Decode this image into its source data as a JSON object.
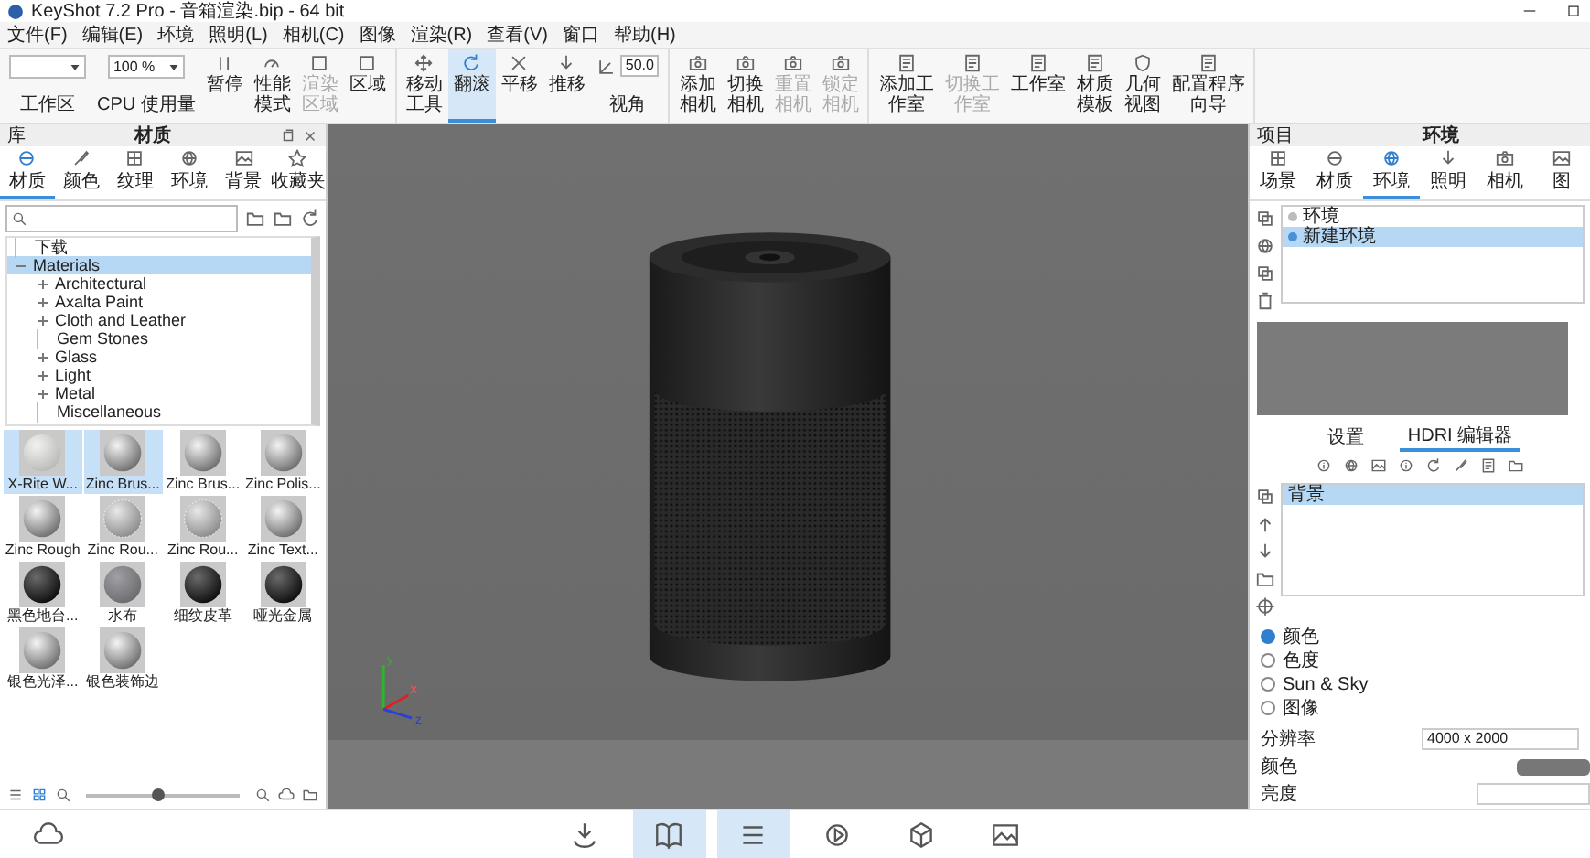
{
  "window": {
    "title": "KeyShot 7.2 Pro - 音箱渲染.bip - 64 bit"
  },
  "menu": [
    "文件(F)",
    "编辑(E)",
    "环境",
    "照明(L)",
    "相机(C)",
    "图像",
    "渲染(R)",
    "查看(V)",
    "窗口",
    "帮助(H)"
  ],
  "toolbar": {
    "groups": [
      {
        "items": [
          {
            "kind": "dropdown",
            "value": "",
            "label": "工作区"
          },
          {
            "kind": "dropdown",
            "value": "100 %",
            "label": "CPU 使用量"
          },
          {
            "kind": "button",
            "label": "暂停",
            "disabled": false,
            "selected": false
          },
          {
            "kind": "button",
            "label": "性能模式",
            "disabled": false,
            "selected": false
          },
          {
            "kind": "button",
            "label": "渲染区域",
            "disabled": true,
            "selected": false
          },
          {
            "kind": "button",
            "label": "区域",
            "disabled": false,
            "selected": false
          }
        ]
      },
      {
        "items": [
          {
            "kind": "button",
            "label": "移动工具",
            "disabled": false,
            "selected": false
          },
          {
            "kind": "button",
            "label": "翻滚",
            "disabled": false,
            "selected": true
          },
          {
            "kind": "button",
            "label": "平移",
            "disabled": false,
            "selected": false
          },
          {
            "kind": "button",
            "label": "推移",
            "disabled": false,
            "selected": false
          },
          {
            "kind": "field",
            "value": "50.0",
            "label": "视角"
          }
        ]
      },
      {
        "items": [
          {
            "kind": "button",
            "label": "添加相机",
            "disabled": false,
            "selected": false
          },
          {
            "kind": "button",
            "label": "切换相机",
            "disabled": false,
            "selected": false
          },
          {
            "kind": "button",
            "label": "重置相机",
            "disabled": true,
            "selected": false
          },
          {
            "kind": "button",
            "label": "锁定相机",
            "disabled": true,
            "selected": false
          }
        ]
      },
      {
        "items": [
          {
            "kind": "button",
            "label": "添加工作室",
            "disabled": false,
            "selected": false
          },
          {
            "kind": "button",
            "label": "切换工作室",
            "disabled": true,
            "selected": false
          },
          {
            "kind": "button",
            "label": "工作室",
            "disabled": false,
            "selected": false
          },
          {
            "kind": "button",
            "label": "材质模板",
            "disabled": false,
            "selected": false
          },
          {
            "kind": "button",
            "label": "几何视图",
            "disabled": false,
            "selected": false
          },
          {
            "kind": "button",
            "label": "配置程序向导",
            "disabled": false,
            "selected": false
          }
        ]
      }
    ]
  },
  "library": {
    "header": "库",
    "title": "材质",
    "tabs": [
      {
        "label": "材质",
        "selected": true
      },
      {
        "label": "颜色",
        "selected": false
      },
      {
        "label": "纹理",
        "selected": false
      },
      {
        "label": "环境",
        "selected": false
      },
      {
        "label": "背景",
        "selected": false
      },
      {
        "label": "收藏夹",
        "selected": false
      }
    ],
    "tree": [
      {
        "kind": "leaf",
        "label": "下载",
        "selected": false
      },
      {
        "kind": "folder",
        "label": "Materials",
        "selected": true,
        "expanded": true,
        "children": [
          {
            "kind": "folder",
            "label": "Architectural",
            "selected": false,
            "expanded": false
          },
          {
            "kind": "folder",
            "label": "Axalta Paint",
            "selected": false,
            "expanded": false
          },
          {
            "kind": "folder",
            "label": "Cloth and Leather",
            "selected": false,
            "expanded": false
          },
          {
            "kind": "leaf",
            "label": "Gem Stones",
            "selected": false
          },
          {
            "kind": "folder",
            "label": "Glass",
            "selected": false,
            "expanded": false
          },
          {
            "kind": "folder",
            "label": "Light",
            "selected": false,
            "expanded": false
          },
          {
            "kind": "folder",
            "label": "Metal",
            "selected": false,
            "expanded": false
          },
          {
            "kind": "leaf",
            "label": "Miscellaneous",
            "selected": false
          }
        ]
      }
    ],
    "thumbnails": [
      {
        "label": "X-Rite W...",
        "kind": "white",
        "selected": true
      },
      {
        "label": "Zinc Brus...",
        "kind": "chrome",
        "selected": true
      },
      {
        "label": "Zinc Brus...",
        "kind": "chrome",
        "selected": false
      },
      {
        "label": "Zinc Polis...",
        "kind": "chrome",
        "selected": false
      },
      {
        "label": "Zinc Rough",
        "kind": "chrome",
        "selected": false
      },
      {
        "label": "Zinc Rou...",
        "kind": "mesh",
        "selected": false
      },
      {
        "label": "Zinc Rou...",
        "kind": "mesh",
        "selected": false
      },
      {
        "label": "Zinc Text...",
        "kind": "chrome",
        "selected": false
      },
      {
        "label": "黑色地台...",
        "kind": "black",
        "selected": false
      },
      {
        "label": "水布",
        "kind": "fabric",
        "selected": false
      },
      {
        "label": "细纹皮革",
        "kind": "black",
        "selected": false
      },
      {
        "label": "哑光金属",
        "kind": "black",
        "selected": false
      },
      {
        "label": "银色光泽...",
        "kind": "chrome",
        "selected": false
      },
      {
        "label": "银色装饰边",
        "kind": "chrome",
        "selected": false
      }
    ],
    "size_slider": {
      "level": 0.47
    }
  },
  "viewport": {
    "axis_labels": [
      "y",
      "x",
      "z"
    ]
  },
  "project": {
    "header": "项目",
    "title": "环境",
    "tabs": [
      {
        "label": "场景",
        "selected": false
      },
      {
        "label": "材质",
        "selected": false
      },
      {
        "label": "环境",
        "selected": true
      },
      {
        "label": "照明",
        "selected": false
      },
      {
        "label": "相机",
        "selected": false
      },
      {
        "label": "图",
        "selected": false
      }
    ],
    "environments": [
      {
        "label": "环境",
        "selected": false
      },
      {
        "label": "新建环境",
        "selected": true
      }
    ],
    "subtabs": [
      {
        "label": "设置",
        "selected": false
      },
      {
        "label": "HDRI 编辑器",
        "selected": true
      }
    ],
    "layers": [
      {
        "label": "背景",
        "selected": true
      }
    ],
    "background_options": [
      {
        "label": "颜色",
        "selected": true
      },
      {
        "label": "色度",
        "selected": false
      },
      {
        "label": "Sun & Sky",
        "selected": false
      },
      {
        "label": "图像",
        "selected": false
      }
    ],
    "fields": [
      {
        "label": "分辨率",
        "kind": "text",
        "value": "4000 x 2000"
      },
      {
        "label": "颜色",
        "kind": "swatch"
      },
      {
        "label": "亮度",
        "kind": "input"
      }
    ]
  },
  "bottom_bar": {
    "buttons": [
      {
        "selected": false
      },
      {
        "selected": false
      },
      {
        "selected": true
      },
      {
        "selected": true
      },
      {
        "selected": false
      },
      {
        "selected": false
      },
      {
        "selected": false
      }
    ]
  }
}
